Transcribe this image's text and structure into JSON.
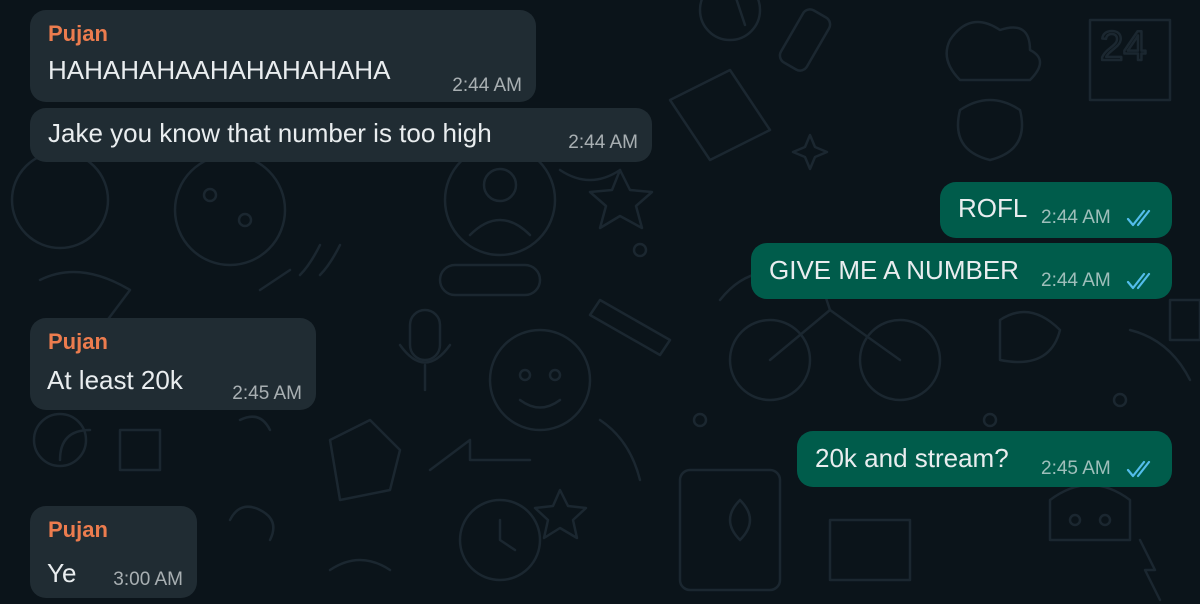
{
  "messages": [
    {
      "direction": "incoming",
      "sender": "Pujan",
      "text": "HAHAHAHAAHAHAHAHAHA",
      "time": "2:44 AM"
    },
    {
      "direction": "incoming",
      "sender": "",
      "text": "Jake you know that number is too high",
      "time": "2:44 AM"
    },
    {
      "direction": "outgoing",
      "text": "ROFL",
      "time": "2:44 AM",
      "status": "read",
      "status_icon": "double-check-icon"
    },
    {
      "direction": "outgoing",
      "text": "GIVE ME A NUMBER",
      "time": "2:44 AM",
      "status": "read",
      "status_icon": "double-check-icon"
    },
    {
      "direction": "incoming",
      "sender": "Pujan",
      "text": "At least 20k",
      "time": "2:45 AM"
    },
    {
      "direction": "outgoing",
      "text": "20k and stream?",
      "time": "2:45 AM",
      "status": "read",
      "status_icon": "double-check-icon"
    },
    {
      "direction": "incoming",
      "sender": "Pujan",
      "text": "Ye",
      "time": "3:00 AM"
    }
  ],
  "colors": {
    "background": "#0b141a",
    "incoming_bubble": "#202c33",
    "outgoing_bubble": "#005c4b",
    "sender_name": "#ec7c4e",
    "message_text": "#e9edef",
    "read_ticks": "#53bdeb"
  }
}
